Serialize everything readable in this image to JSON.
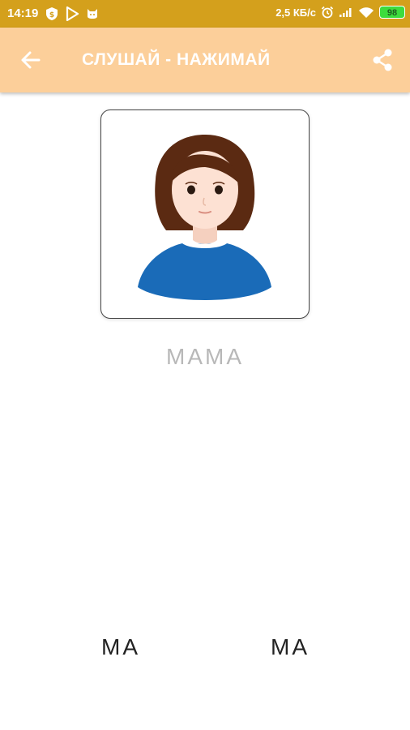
{
  "status_bar": {
    "time": "14:19",
    "speed": "2,5 КБ/с",
    "battery": "98"
  },
  "app_bar": {
    "title": "СЛУШАЙ - НАЖИМАЙ"
  },
  "card": {
    "icon": "mother-portrait-icon",
    "word": "МАМА"
  },
  "syllables": [
    "МА",
    "МА"
  ],
  "colors": {
    "status_bar": "#d4a01c",
    "app_bar": "#fccf9a",
    "word": "#b8b8b8",
    "shirt": "#1a6bb8",
    "hair": "#5b2a12"
  }
}
